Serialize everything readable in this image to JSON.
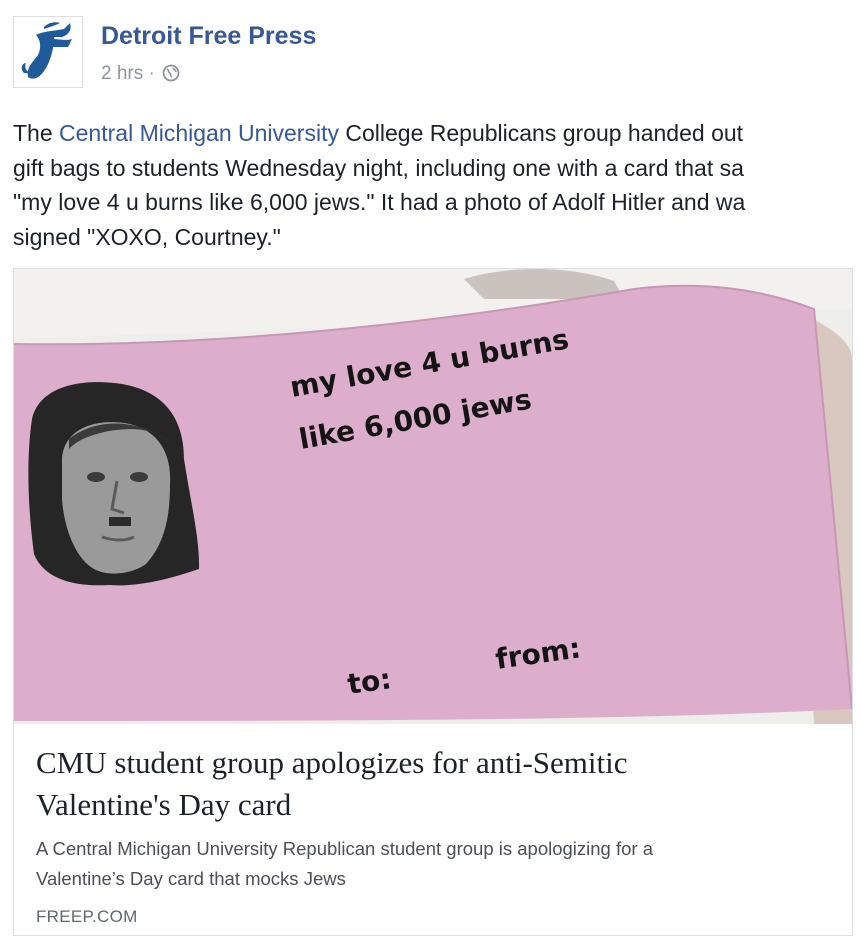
{
  "page": {
    "name": "Detroit Free Press",
    "time": "2 hrs",
    "separator": "·",
    "avatar_icon": "freep-logo-icon",
    "audience_icon": "globe-icon"
  },
  "post": {
    "text_1": "The ",
    "link": "Central Michigan University",
    "text_2": " College Republicans group handed out",
    "line_2": "gift bags to students Wednesday night, including one with a card that sa",
    "line_3": "\"my love 4 u burns like 6,000 jews.\" It had a photo of Adolf Hitler and wa",
    "line_4": "signed \"XOXO, Courtney.\""
  },
  "card_photo": {
    "line_1": "my love 4 u burns",
    "line_2": "like 6,000 jews",
    "to": "to:",
    "from": "from:",
    "colors": {
      "paper": "#dcaecc",
      "background": "#efefec"
    }
  },
  "link_preview": {
    "headline_line_1": "CMU student group apologizes for anti-Semitic",
    "headline_line_2": "Valentine's Day card",
    "desc_line_1": "A Central Michigan University Republican student group is apologizing for a",
    "desc_line_2": "Valentine’s Day card that mocks Jews",
    "domain": "FREEP.COM"
  },
  "colors": {
    "link": "#365899",
    "meta": "#90949c",
    "text": "#1d2129"
  }
}
